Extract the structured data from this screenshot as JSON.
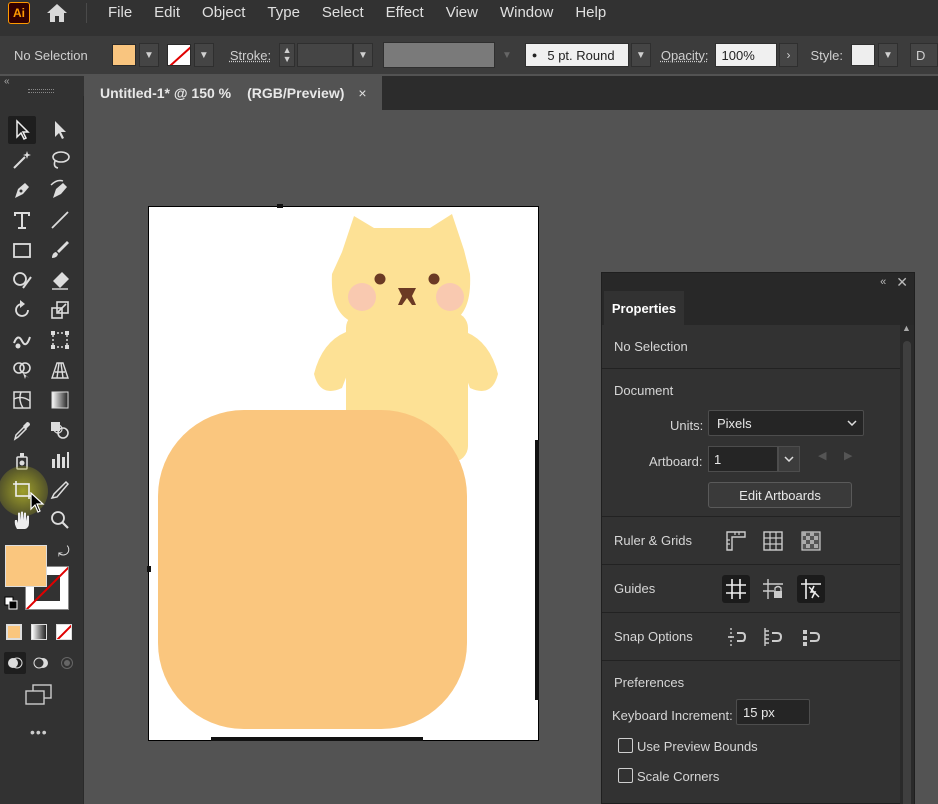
{
  "app": {
    "logo_text": "Ai"
  },
  "menu": [
    "File",
    "Edit",
    "Object",
    "Type",
    "Select",
    "Effect",
    "View",
    "Window",
    "Help"
  ],
  "control_bar": {
    "selection": "No Selection",
    "stroke_label": "Stroke:",
    "brush": "5 pt. Round",
    "opacity_label": "Opacity:",
    "opacity_value": "100%",
    "style_label": "Style:",
    "trailing": "D"
  },
  "document_tab": {
    "title": "Untitled-1* @ 150 %",
    "mode": "(RGB/Preview)",
    "close": "×"
  },
  "colors": {
    "fill": "#fac67e",
    "bear": "#fde195",
    "cheek": "#f9c9b0",
    "panel": "#323232"
  },
  "properties": {
    "tab": "Properties",
    "selection": "No Selection",
    "document": {
      "title": "Document",
      "units_label": "Units:",
      "units_value": "Pixels",
      "artboard_label": "Artboard:",
      "artboard_value": "1",
      "edit_button": "Edit Artboards"
    },
    "ruler_grids": "Ruler & Grids",
    "guides": "Guides",
    "snap": "Snap Options",
    "preferences": {
      "title": "Preferences",
      "keyboard_label": "Keyboard Increment:",
      "keyboard_value": "15 px",
      "preview_bounds": "Use Preview Bounds",
      "scale_corners": "Scale Corners"
    }
  },
  "toolbar": {
    "more": "•••"
  }
}
